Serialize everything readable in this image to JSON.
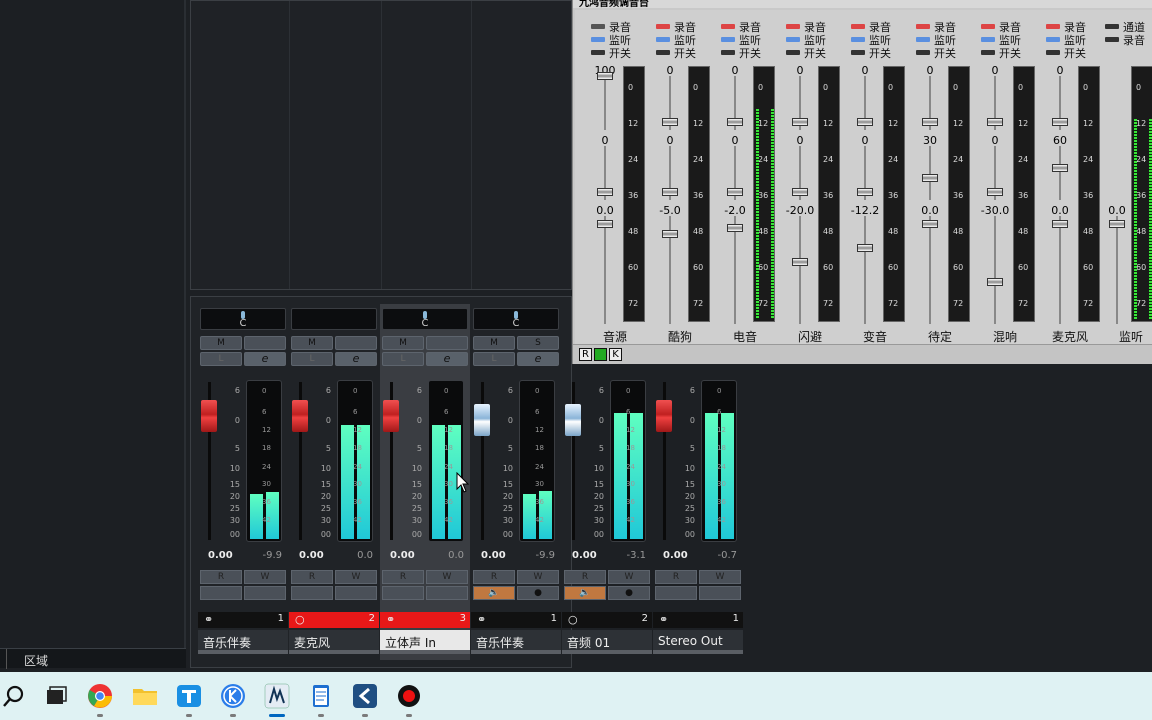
{
  "left_panel": {
    "zone_label": "区域"
  },
  "mixer": {
    "strips": [
      {
        "pan": "C",
        "m": "M",
        "s": "",
        "l": "L",
        "e": "e",
        "vol": "0.00",
        "peak": "-9.9",
        "r": "R",
        "w": "W",
        "chan_num": "1",
        "name": "音乐伴奏",
        "rec": false,
        "selected": false
      },
      {
        "pan": "",
        "m": "M",
        "s": "",
        "l": "L",
        "e": "e",
        "vol": "0.00",
        "peak": "0.0",
        "r": "R",
        "w": "W",
        "chan_num": "2",
        "name": "麦克风",
        "rec": true,
        "selected": false
      },
      {
        "pan": "C",
        "m": "M",
        "s": "",
        "l": "L",
        "e": "e",
        "vol": "0.00",
        "peak": "0.0",
        "r": "R",
        "w": "W",
        "chan_num": "3",
        "name": "立体声 In",
        "rec": true,
        "selected": true
      },
      {
        "pan": "C",
        "m": "M",
        "s": "S",
        "l": "L",
        "e": "e",
        "vol": "0.00",
        "peak": "-9.9",
        "r": "R",
        "w": "W",
        "chan_num": "1",
        "name": "音乐伴奏",
        "rec": false,
        "selected": false
      },
      {
        "vol": "0.00",
        "peak": "-3.1",
        "r": "R",
        "w": "W",
        "chan_num": "2",
        "name": "音频 01",
        "rec": false,
        "selected": false
      },
      {
        "vol": "0.00",
        "peak": "-0.7",
        "r": "R",
        "w": "W",
        "chan_num": "1",
        "name": "Stereo Out",
        "rec": false,
        "selected": false
      }
    ],
    "fader_scale": [
      "6",
      "0",
      "5",
      "10",
      "15",
      "20",
      "25",
      "30",
      "00"
    ],
    "meter_scale": [
      "0",
      "6",
      "12",
      "18",
      "24",
      "30",
      "36",
      "42"
    ],
    "meter_levels": [
      [
        0.29,
        0.3
      ],
      [
        0.73,
        0.73
      ],
      [
        0.73,
        0.73
      ],
      [
        0.29,
        0.31
      ],
      [
        0.81,
        0.81
      ],
      [
        0.81,
        0.81
      ]
    ],
    "fader_styles": [
      "red",
      "red",
      "red",
      "blue",
      "blue",
      "red"
    ]
  },
  "window": {
    "title": "九鸿音频调音台",
    "check_labels": {
      "rec": "录音",
      "mon": "监听",
      "sw": "开关"
    },
    "meter_scale": [
      "0",
      "12",
      "24",
      "36",
      "48",
      "60",
      "72"
    ],
    "channels": [
      {
        "name": "音源",
        "v1": "100",
        "v2": "0",
        "v3": "0.0"
      },
      {
        "name": "酷狗",
        "v1": "0",
        "v2": "0",
        "v3": "-5.0"
      },
      {
        "name": "电音",
        "v1": "0",
        "v2": "0",
        "v3": "-2.0"
      },
      {
        "name": "闪避",
        "v1": "0",
        "v2": "0",
        "v3": "-20.0"
      },
      {
        "name": "变音",
        "v1": "0",
        "v2": "0",
        "v3": "-12.2"
      },
      {
        "name": "待定",
        "v1": "0",
        "v2": "30",
        "v3": "0.0"
      },
      {
        "name": "混响",
        "v1": "0",
        "v2": "0",
        "v3": "-30.0"
      },
      {
        "name": "麦克风",
        "v1": "0",
        "v2": "60",
        "v3": "0.0"
      }
    ],
    "monitor": {
      "name": "监听",
      "v3": "0.0",
      "check1": "通道",
      "check2": "录音"
    },
    "footer": [
      "R",
      "",
      "K"
    ]
  },
  "colors": {
    "meter_cyan": "#20c8d8",
    "rec_red": "#e81818",
    "accent_blue": "#0067c0"
  }
}
